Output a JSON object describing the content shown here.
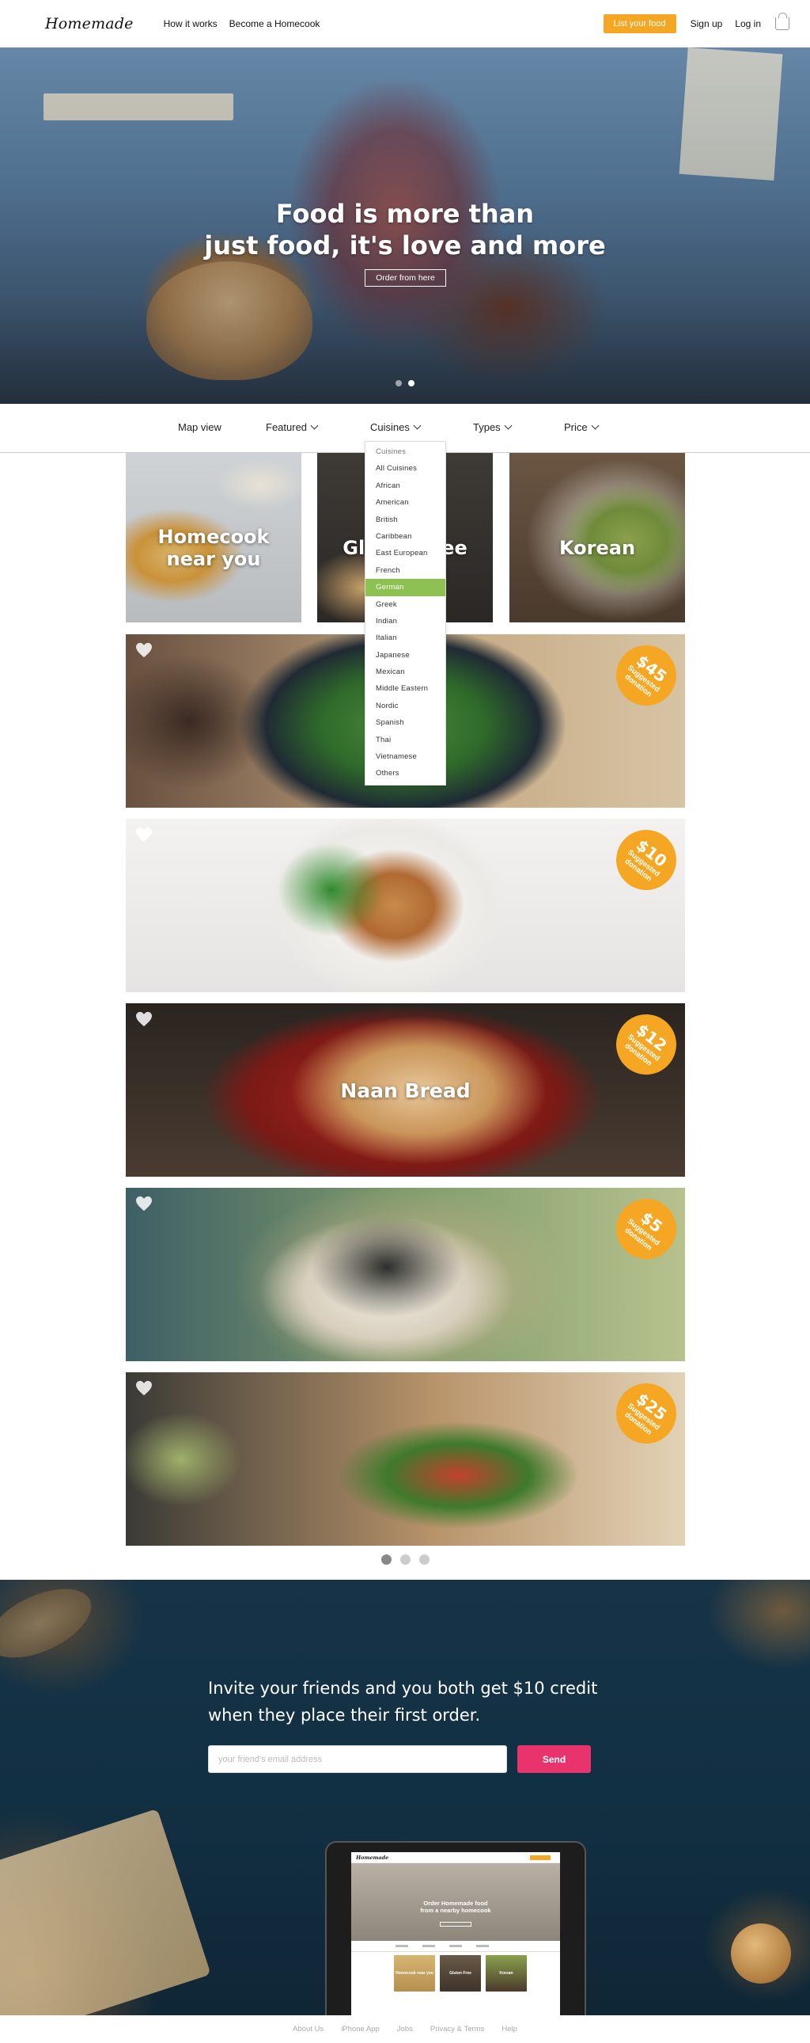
{
  "header": {
    "logo": "Homemade",
    "nav": [
      "How it works",
      "Become a Homecook"
    ],
    "list_food": "List your food",
    "sign_up": "Sign up",
    "log_in": "Log in"
  },
  "hero": {
    "title_line1": "Food is more than",
    "title_line2": "just food, it's love and more",
    "cta": "Order from here",
    "slide_count": 2,
    "active_slide": 2
  },
  "filters": {
    "map_view": "Map view",
    "featured": "Featured",
    "cuisines": "Cuisines",
    "types": "Types",
    "price": "Price"
  },
  "cuisines_dropdown": {
    "header": "Cuisines",
    "selected": "German",
    "items": [
      "All Cuisines",
      "African",
      "American",
      "British",
      "Caribbean",
      "East European",
      "French",
      "German",
      "Greek",
      "Indian",
      "Italian",
      "Japanese",
      "Mexican",
      "Middle Eastern",
      "Nordic",
      "Spanish",
      "Thai",
      "Vietnamese",
      "Others"
    ]
  },
  "tiles": {
    "homecook_line1": "Homecook",
    "homecook_line2": "near you",
    "gluten_free": "Gluten Free",
    "korean": "Korean"
  },
  "cards": [
    {
      "price": "$45",
      "label": "Suggested donation",
      "title": ""
    },
    {
      "price": "$10",
      "label": "Suggested donation",
      "title": ""
    },
    {
      "price": "$12",
      "label": "Suggested donation",
      "title": "Naan Bread"
    },
    {
      "price": "$5",
      "label": "Suggested donation",
      "title": ""
    },
    {
      "price": "$25",
      "label": "Suggested donation",
      "title": ""
    }
  ],
  "pager": {
    "pages": 3,
    "current": 1
  },
  "invite": {
    "line1": "Invite your friends and you both get $10 credit",
    "line2": "when they place their first order.",
    "placeholder": "your friend's email address",
    "send": "Send"
  },
  "tablet": {
    "logo": "Homemade",
    "hero_line1": "Order Homemade food",
    "hero_line2": "from a nearby homecook",
    "tile1": "Homecook near you",
    "tile2": "Gluten Free",
    "tile3": "Korean"
  },
  "footer": {
    "links": [
      "About Us",
      "iPhone App",
      "Jobs",
      "Privacy & Terms",
      "Help"
    ]
  },
  "colors": {
    "accent_orange": "#f5a623",
    "send_pink": "#e8336c",
    "selected_green": "#8dc152",
    "invite_bg": "#133245"
  }
}
